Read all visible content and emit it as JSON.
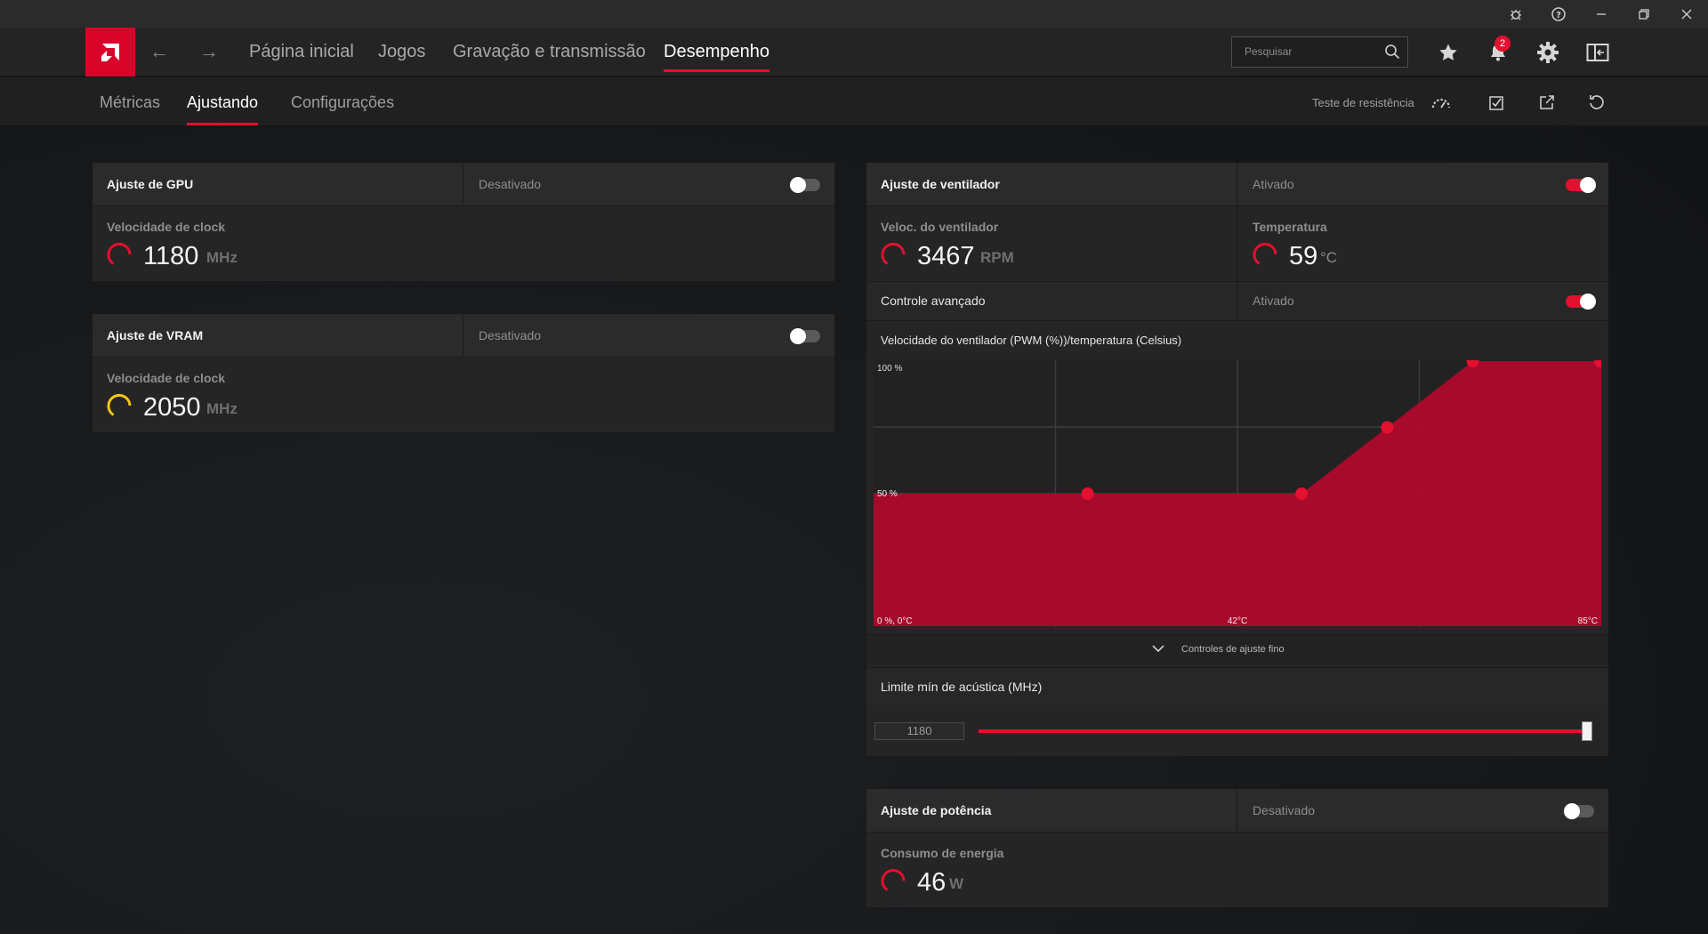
{
  "window_controls": [
    "bug-icon",
    "help-icon",
    "minimize-icon",
    "restore-icon",
    "close-icon"
  ],
  "nav": {
    "links": [
      {
        "label": "Página inicial"
      },
      {
        "label": "Jogos"
      },
      {
        "label": "Gravação e transmissão"
      },
      {
        "label": "Desempenho",
        "active": true
      }
    ],
    "search_placeholder": "Pesquisar",
    "notification_count": "2"
  },
  "subnav": {
    "tabs": [
      {
        "label": "Métricas"
      },
      {
        "label": "Ajustando",
        "active": true
      },
      {
        "label": "Configurações"
      }
    ],
    "stress_test_label": "Teste de resistência"
  },
  "gpu": {
    "title": "Ajuste de GPU",
    "status": "Desativado",
    "enabled": false,
    "metric_label": "Velocidade de clock",
    "value": "1180",
    "unit": "MHz",
    "gauge_color": "#e3102f"
  },
  "vram": {
    "title": "Ajuste de VRAM",
    "status": "Desativado",
    "enabled": false,
    "metric_label": "Velocidade de clock",
    "value": "2050",
    "unit": "MHz",
    "gauge_color": "#f5c518"
  },
  "fan": {
    "title": "Ajuste de ventilador",
    "status": "Ativado",
    "enabled": true,
    "speed_label": "Veloc. do ventilador",
    "speed_value": "3467",
    "speed_unit": "RPM",
    "temp_label": "Temperatura",
    "temp_value": "59",
    "temp_unit": "°C",
    "advanced_label": "Controle avançado",
    "advanced_status": "Ativado",
    "advanced_enabled": true,
    "fine_tune_label": "Controles de ajuste fino",
    "acoustic_label": "Limite mín de acústica (MHz)",
    "acoustic_value": "1180",
    "acoustic_fraction": 1.0
  },
  "power": {
    "title": "Ajuste de potência",
    "status": "Desativado",
    "enabled": false,
    "metric_label": "Consumo de energia",
    "value": "46",
    "unit": "W"
  },
  "chart_data": {
    "type": "area",
    "title": "Velocidade do ventilador (PWM (%))/temperatura (Celsius)",
    "x": [
      0,
      25,
      50,
      60,
      70,
      85
    ],
    "values": [
      50,
      50,
      50,
      75,
      100,
      100
    ],
    "points": [
      {
        "x": 25,
        "y": 50
      },
      {
        "x": 50,
        "y": 50
      },
      {
        "x": 60,
        "y": 75
      },
      {
        "x": 70,
        "y": 100
      },
      {
        "x": 85,
        "y": 100
      }
    ],
    "xlim": [
      0,
      85
    ],
    "ylim": [
      0,
      100
    ],
    "labels": {
      "y_top": "100 %",
      "y_mid": "50 %",
      "origin": "0 %, 0°C",
      "x_mid": "42°C",
      "x_max": "85°C"
    },
    "grid": true,
    "fill_color": "#b3092c",
    "point_color": "#e3102f"
  }
}
